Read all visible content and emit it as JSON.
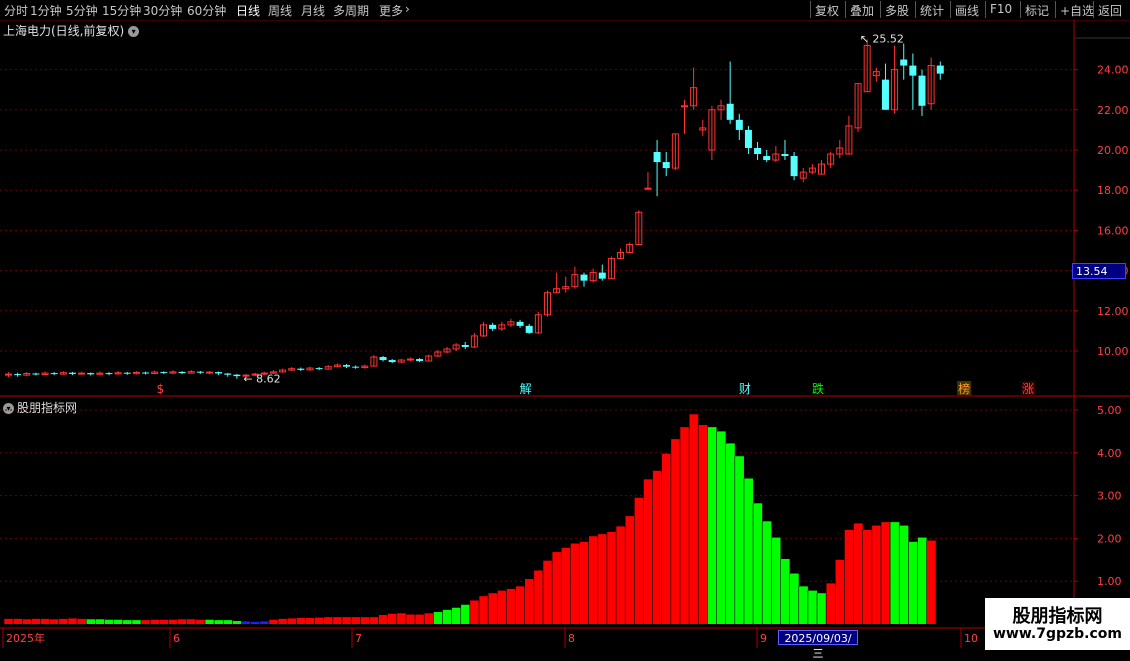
{
  "toolbar": {
    "left": [
      {
        "label": "分时",
        "x": 4
      },
      {
        "label": "1分钟",
        "x": 30
      },
      {
        "label": "5分钟",
        "x": 66
      },
      {
        "label": "15分钟",
        "x": 102
      },
      {
        "label": "30分钟",
        "x": 143
      },
      {
        "label": "60分钟",
        "x": 187
      },
      {
        "label": "日线",
        "x": 236,
        "active": true
      },
      {
        "label": "周线",
        "x": 268
      },
      {
        "label": "月线",
        "x": 301
      },
      {
        "label": "多周期",
        "x": 333
      },
      {
        "label": "更多",
        "x": 379
      }
    ],
    "more_arrow": "›",
    "right": [
      "复权",
      "叠加",
      "多股",
      "统计",
      "画线",
      "F10",
      "标记",
      "+自选",
      "返回"
    ]
  },
  "chart_title": "上海电力(日线,前复权)",
  "panel2_title": "股朋指标网",
  "price_label": "13.54",
  "selected_date": "2025/09/03/三",
  "watermark": {
    "line1": "股朋指标网",
    "line2": "www.7gpzb.com"
  },
  "markers": [
    "$",
    "解",
    "财",
    "跌",
    "榜",
    "涨"
  ],
  "high_label": "25.52",
  "low_label": "8.62",
  "colors": {
    "up": "#ff3232",
    "down": "#54ffff",
    "bar_up": "#ff0000",
    "bar_down": "#00ff00",
    "axis": "#b00000",
    "grid": "#6a0000"
  },
  "chart_data": [
    {
      "type": "candlestick",
      "y_ticks": [
        10,
        12,
        14,
        16,
        18,
        20,
        22,
        24
      ],
      "ylim": [
        8.0,
        26.0
      ],
      "annotations": [
        {
          "text": "25.52"
        },
        {
          "text": "8.62"
        }
      ],
      "candles": [
        [
          8.8,
          8.85,
          8.95,
          8.7
        ],
        [
          8.85,
          8.8,
          8.92,
          8.72
        ],
        [
          8.8,
          8.88,
          8.95,
          8.75
        ],
        [
          8.88,
          8.83,
          8.92,
          8.78
        ],
        [
          8.83,
          8.9,
          8.98,
          8.8
        ],
        [
          8.9,
          8.85,
          8.95,
          8.8
        ],
        [
          8.85,
          8.92,
          9.0,
          8.82
        ],
        [
          8.92,
          8.86,
          8.96,
          8.8
        ],
        [
          8.86,
          8.9,
          8.97,
          8.82
        ],
        [
          8.9,
          8.84,
          8.93,
          8.78
        ],
        [
          8.84,
          8.9,
          8.98,
          8.8
        ],
        [
          8.9,
          8.86,
          8.95,
          8.8
        ],
        [
          8.86,
          8.92,
          9.0,
          8.82
        ],
        [
          8.92,
          8.87,
          8.96,
          8.82
        ],
        [
          8.87,
          8.93,
          9.0,
          8.84
        ],
        [
          8.93,
          8.88,
          8.97,
          8.83
        ],
        [
          8.88,
          8.95,
          9.02,
          8.85
        ],
        [
          8.95,
          8.9,
          8.99,
          8.85
        ],
        [
          8.9,
          8.96,
          9.04,
          8.87
        ],
        [
          8.96,
          8.9,
          9.0,
          8.85
        ],
        [
          8.9,
          8.97,
          9.05,
          8.88
        ],
        [
          8.97,
          8.92,
          9.01,
          8.86
        ],
        [
          8.92,
          8.95,
          9.0,
          8.85
        ],
        [
          8.95,
          8.88,
          8.98,
          8.8
        ],
        [
          8.88,
          8.82,
          8.9,
          8.72
        ],
        [
          8.82,
          8.75,
          8.86,
          8.62
        ],
        [
          8.75,
          8.8,
          8.86,
          8.68
        ],
        [
          8.8,
          8.85,
          8.92,
          8.75
        ],
        [
          8.85,
          8.9,
          8.97,
          8.8
        ],
        [
          8.9,
          8.96,
          9.05,
          8.86
        ],
        [
          8.96,
          9.05,
          9.12,
          8.92
        ],
        [
          9.05,
          9.12,
          9.2,
          9.0
        ],
        [
          9.12,
          9.06,
          9.18,
          9.0
        ],
        [
          9.06,
          9.15,
          9.22,
          9.02
        ],
        [
          9.15,
          9.1,
          9.2,
          9.05
        ],
        [
          9.1,
          9.22,
          9.3,
          9.08
        ],
        [
          9.22,
          9.3,
          9.38,
          9.18
        ],
        [
          9.3,
          9.22,
          9.35,
          9.15
        ],
        [
          9.22,
          9.18,
          9.28,
          9.12
        ],
        [
          9.18,
          9.25,
          9.32,
          9.12
        ],
        [
          9.25,
          9.7,
          9.8,
          9.22
        ],
        [
          9.7,
          9.55,
          9.75,
          9.48
        ],
        [
          9.55,
          9.45,
          9.6,
          9.4
        ],
        [
          9.45,
          9.55,
          9.62,
          9.4
        ],
        [
          9.55,
          9.6,
          9.68,
          9.5
        ],
        [
          9.6,
          9.5,
          9.65,
          9.45
        ],
        [
          9.5,
          9.75,
          9.82,
          9.48
        ],
        [
          9.75,
          9.95,
          10.05,
          9.7
        ],
        [
          9.95,
          10.1,
          10.2,
          9.9
        ],
        [
          10.1,
          10.3,
          10.4,
          10.0
        ],
        [
          10.3,
          10.2,
          10.45,
          10.1
        ],
        [
          10.2,
          10.75,
          10.9,
          10.15
        ],
        [
          10.75,
          11.3,
          11.45,
          10.7
        ],
        [
          11.3,
          11.1,
          11.4,
          11.0
        ],
        [
          11.1,
          11.3,
          11.45,
          11.0
        ],
        [
          11.3,
          11.45,
          11.6,
          11.2
        ],
        [
          11.45,
          11.25,
          11.55,
          11.15
        ],
        [
          11.25,
          10.9,
          11.35,
          10.85
        ],
        [
          10.9,
          11.8,
          11.95,
          10.85
        ],
        [
          11.8,
          12.9,
          13.0,
          11.7
        ],
        [
          12.9,
          13.1,
          13.9,
          12.9
        ],
        [
          13.1,
          13.2,
          13.7,
          12.9
        ],
        [
          13.2,
          13.8,
          14.2,
          13.1
        ],
        [
          13.8,
          13.5,
          13.9,
          13.2
        ],
        [
          13.5,
          13.9,
          14.1,
          13.4
        ],
        [
          13.9,
          13.6,
          14.3,
          13.5
        ],
        [
          13.6,
          14.6,
          14.7,
          13.6
        ],
        [
          14.6,
          14.9,
          15.1,
          14.6
        ],
        [
          14.9,
          15.3,
          15.4,
          14.9
        ],
        [
          15.3,
          16.9,
          17.0,
          15.3
        ],
        [
          18.1,
          18.1,
          18.9,
          18.0
        ],
        [
          19.9,
          19.4,
          20.5,
          17.7
        ],
        [
          19.4,
          19.1,
          19.9,
          18.7
        ],
        [
          19.1,
          20.8,
          20.8,
          19.0
        ],
        [
          22.2,
          22.2,
          22.5,
          20.8
        ],
        [
          22.2,
          23.1,
          24.1,
          22.0
        ],
        [
          21.0,
          21.1,
          21.5,
          20.7
        ],
        [
          20.0,
          22.0,
          22.2,
          19.5
        ],
        [
          22.0,
          22.2,
          22.5,
          21.5
        ],
        [
          22.3,
          21.5,
          24.4,
          21.3
        ],
        [
          21.5,
          21.0,
          21.8,
          20.5
        ],
        [
          21.0,
          20.1,
          21.2,
          19.8
        ],
        [
          20.1,
          19.8,
          20.4,
          19.5
        ],
        [
          19.7,
          19.5,
          20.0,
          19.4
        ],
        [
          19.5,
          19.8,
          20.2,
          19.4
        ],
        [
          19.8,
          19.7,
          20.5,
          19.5
        ],
        [
          19.7,
          18.7,
          19.9,
          18.5
        ],
        [
          18.6,
          18.9,
          19.1,
          18.4
        ],
        [
          18.9,
          19.1,
          19.3,
          18.8
        ],
        [
          18.8,
          19.3,
          19.5,
          18.8
        ],
        [
          19.3,
          19.8,
          19.9,
          19.1
        ],
        [
          19.8,
          20.1,
          20.5,
          19.6
        ],
        [
          19.8,
          21.2,
          21.7,
          19.8
        ],
        [
          21.1,
          23.3,
          23.3,
          20.9
        ],
        [
          22.9,
          25.2,
          25.5,
          22.9
        ],
        [
          23.7,
          23.9,
          24.1,
          23.4
        ],
        [
          23.5,
          22.0,
          24.3,
          22.0
        ],
        [
          22.0,
          24.0,
          25.2,
          21.8
        ],
        [
          24.5,
          24.2,
          25.3,
          23.5
        ],
        [
          24.2,
          23.7,
          24.8,
          22.0
        ],
        [
          23.7,
          22.2,
          24.0,
          21.7
        ],
        [
          22.3,
          24.2,
          24.6,
          22.0
        ],
        [
          24.2,
          23.8,
          24.4,
          23.5
        ]
      ],
      "markers": [
        {
          "text": "$"
        },
        {
          "text": "解"
        },
        {
          "text": "财"
        },
        {
          "text": "跌"
        },
        {
          "text": "榜"
        },
        {
          "text": "涨"
        }
      ]
    },
    {
      "type": "bar",
      "title": "股朋指标网",
      "y_ticks": [
        1.0,
        2.0,
        3.0,
        4.0,
        5.0
      ],
      "ylim": [
        0,
        5.4
      ],
      "x_ticks": [
        "2025年",
        "6",
        "7",
        "8",
        "9",
        "10"
      ],
      "values": [
        0.12,
        0.12,
        0.11,
        0.12,
        0.12,
        0.11,
        0.12,
        0.13,
        0.12,
        0.11,
        0.11,
        0.1,
        0.1,
        0.09,
        0.09,
        0.09,
        0.1,
        0.1,
        0.1,
        0.11,
        0.11,
        0.1,
        0.1,
        0.09,
        0.09,
        0.07,
        0.06,
        0.05,
        0.06,
        0.1,
        0.12,
        0.13,
        0.14,
        0.14,
        0.15,
        0.16,
        0.16,
        0.16,
        0.16,
        0.16,
        0.16,
        0.21,
        0.24,
        0.25,
        0.22,
        0.22,
        0.25,
        0.28,
        0.33,
        0.38,
        0.45,
        0.55,
        0.65,
        0.72,
        0.78,
        0.82,
        0.88,
        1.05,
        1.25,
        1.48,
        1.68,
        1.78,
        1.88,
        1.92,
        2.05,
        2.1,
        2.15,
        2.28,
        2.52,
        2.95,
        3.38,
        3.58,
        3.98,
        4.32,
        4.6,
        4.9,
        4.65,
        4.6,
        4.5,
        4.22,
        3.92,
        3.4,
        2.82,
        2.4,
        2.02,
        1.52,
        1.18,
        0.88,
        0.78,
        0.72,
        0.95,
        1.5,
        2.2,
        2.35,
        2.2,
        2.3,
        2.38,
        2.38,
        2.3,
        1.92,
        2.02,
        1.95
      ],
      "colors": [
        "r",
        "r",
        "r",
        "r",
        "r",
        "r",
        "r",
        "r",
        "r",
        "g",
        "g",
        "g",
        "g",
        "g",
        "g",
        "r",
        "r",
        "r",
        "r",
        "r",
        "r",
        "r",
        "g",
        "g",
        "g",
        "g",
        "b",
        "b",
        "b",
        "r",
        "r",
        "r",
        "r",
        "r",
        "r",
        "r",
        "r",
        "r",
        "r",
        "r",
        "r",
        "r",
        "r",
        "r",
        "r",
        "r",
        "r",
        "g",
        "g",
        "g",
        "g",
        "r",
        "r",
        "r",
        "r",
        "r",
        "r",
        "r",
        "r",
        "r",
        "r",
        "r",
        "r",
        "r",
        "r",
        "r",
        "r",
        "r",
        "r",
        "r",
        "r",
        "r",
        "r",
        "r",
        "r",
        "r",
        "r",
        "g",
        "g",
        "g",
        "g",
        "g",
        "g",
        "g",
        "g",
        "g",
        "g",
        "g",
        "g",
        "g",
        "r",
        "r",
        "r",
        "r",
        "r",
        "r",
        "r",
        "g",
        "g",
        "g",
        "g"
      ]
    }
  ]
}
